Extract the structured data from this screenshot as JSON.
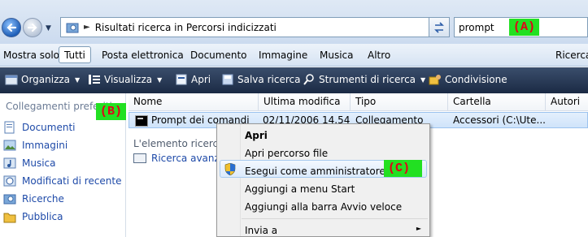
{
  "address_bar": {
    "breadcrumb": "Risultati ricerca in Percorsi indicizzati"
  },
  "search": {
    "value": "prompt"
  },
  "annotations": {
    "a": "(A)",
    "b": "(B)",
    "c": "(C)"
  },
  "filter_bar": {
    "label": "Mostra solo:",
    "tabs": [
      "Tutti",
      "Posta elettronica",
      "Documento",
      "Immagine",
      "Musica",
      "Altro",
      "Ricerca"
    ]
  },
  "toolbar": {
    "items": [
      "Organizza",
      "Visualizza",
      "Apri",
      "Salva ricerca",
      "Strumenti di ricerca",
      "Condivisione"
    ]
  },
  "nav_pane": {
    "heading": "Collegamenti preferiti",
    "items": [
      "Documenti",
      "Immagini",
      "Musica",
      "Modificati di recente",
      "Ricerche",
      "Pubblica"
    ]
  },
  "columns": [
    "Nome",
    "Ultima modifica",
    "Tipo",
    "Cartella",
    "Autori"
  ],
  "results": [
    {
      "name": "Prompt dei comandi",
      "modified": "02/11/2006 14.54",
      "type": "Collegamento",
      "folder": "Accessori (C:\\Ute..."
    }
  ],
  "not_found_label": "L'elemento ricercato",
  "advanced_search": "Ricerca avanzata",
  "context_menu": {
    "items": [
      "Apri",
      "Apri percorso file",
      "Esegui come amministratore",
      "Aggiungi a menu Start",
      "Aggiungi alla barra Avvio veloce",
      "Invia a"
    ]
  },
  "colors": {
    "toolbar_bg": "#1b2a44",
    "annotation_bg": "#22e022",
    "annotation_text": "#e2001a",
    "link_text": "#1e4aa8"
  }
}
